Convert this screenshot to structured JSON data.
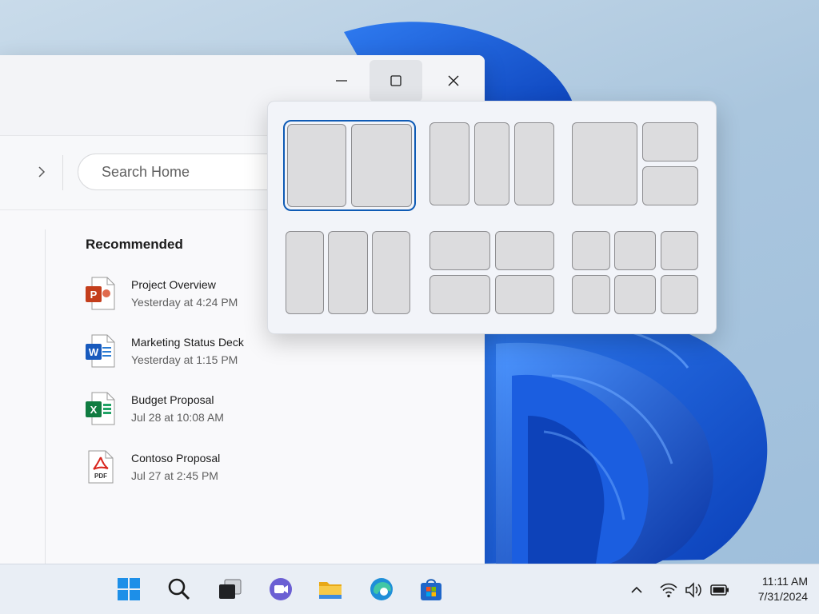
{
  "window": {
    "controls": {
      "minimize": "minimize",
      "maximize": "maximize",
      "close": "close"
    }
  },
  "toolbar": {
    "search_placeholder": "Search Home"
  },
  "recommended": {
    "title": "Recommended",
    "files": [
      {
        "name": "Project Overview",
        "date": "Yesterday at 4:24 PM",
        "icon": "powerpoint-icon",
        "badge": "P"
      },
      {
        "name": "Marketing Status Deck",
        "date": "Yesterday at 1:15 PM",
        "icon": "word-icon",
        "badge": "W"
      },
      {
        "name": "Budget Proposal",
        "date": "Jul 28 at 10:08 AM",
        "icon": "excel-icon",
        "badge": "X"
      },
      {
        "name": "Contoso Proposal",
        "date": "Jul 27 at 2:45 PM",
        "icon": "pdf-icon",
        "badge": "PDF"
      }
    ]
  },
  "snap_layouts": {
    "layouts": [
      {
        "name": "two-halves",
        "selected": true
      },
      {
        "name": "three-columns",
        "selected": false
      },
      {
        "name": "large-left-two-right",
        "selected": false
      },
      {
        "name": "three-columns-wide-center",
        "selected": false
      },
      {
        "name": "four-quadrants",
        "selected": false
      },
      {
        "name": "six-grid",
        "selected": false
      }
    ]
  },
  "taskbar": {
    "apps": [
      "windows-start-icon",
      "search-icon",
      "task-view-icon",
      "teams-icon",
      "file-explorer-icon",
      "edge-icon",
      "store-icon"
    ],
    "tray": [
      "chevron-up-icon",
      "wifi-icon",
      "volume-icon",
      "battery-icon"
    ],
    "time": "11:11 AM",
    "date": "7/31/2024"
  },
  "colors": {
    "accent": "#0f5bb5",
    "powerpoint": "#c43e1c",
    "word": "#185abd",
    "excel": "#107c41",
    "pdf": "#d9251d"
  }
}
